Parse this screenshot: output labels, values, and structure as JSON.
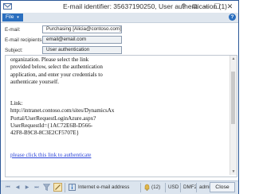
{
  "window": {
    "title": "E-mail identifier: 35637190250, User authentication (1)",
    "controls": {
      "help": "?",
      "restore": "⧉",
      "minimize": "–",
      "maximize": "☐",
      "close": "✕"
    }
  },
  "ribbon": {
    "file_label": "File",
    "file_arrow": "▾",
    "help_label": "?"
  },
  "fields": {
    "email_label": "E-mail:",
    "email_value": "Purchasing [Alicia@contoso.com]",
    "recipients_label": "E-mail recipients:",
    "recipients_value": "email@email.com",
    "subject_label": "Subject:",
    "subject_value": "User authentication"
  },
  "body": {
    "lines": [
      "organization.  Please select the link",
      "provided below, select the authentication",
      "application, and enter your credentials to",
      "authenticate yourself."
    ],
    "link_label": "Link:",
    "link_lines": [
      "http://intranet.contoso.com/sites/DynamicsAx",
      "Portal/UserRequestLoginAzure.aspx?",
      "UserRequestId={1AC72E6B-D566-",
      "42F8-B9C8-8C3E2CF5707E}"
    ],
    "action_link": "please click this link to authenticate"
  },
  "statusbar": {
    "nav_first": "⏮",
    "nav_prev": "◀",
    "nav_next": "▶",
    "nav_last": "⏭",
    "field_name": "Internet e-mail address",
    "alerts": "(12)",
    "currency": "USD",
    "company": "DMF2",
    "session": "admin",
    "close_label": "Close"
  },
  "colors": {
    "accent": "#2b6fbf",
    "ribbon": "#dfe6ee",
    "statusbar": "#dbe4ee",
    "link": "#2a43d8"
  }
}
